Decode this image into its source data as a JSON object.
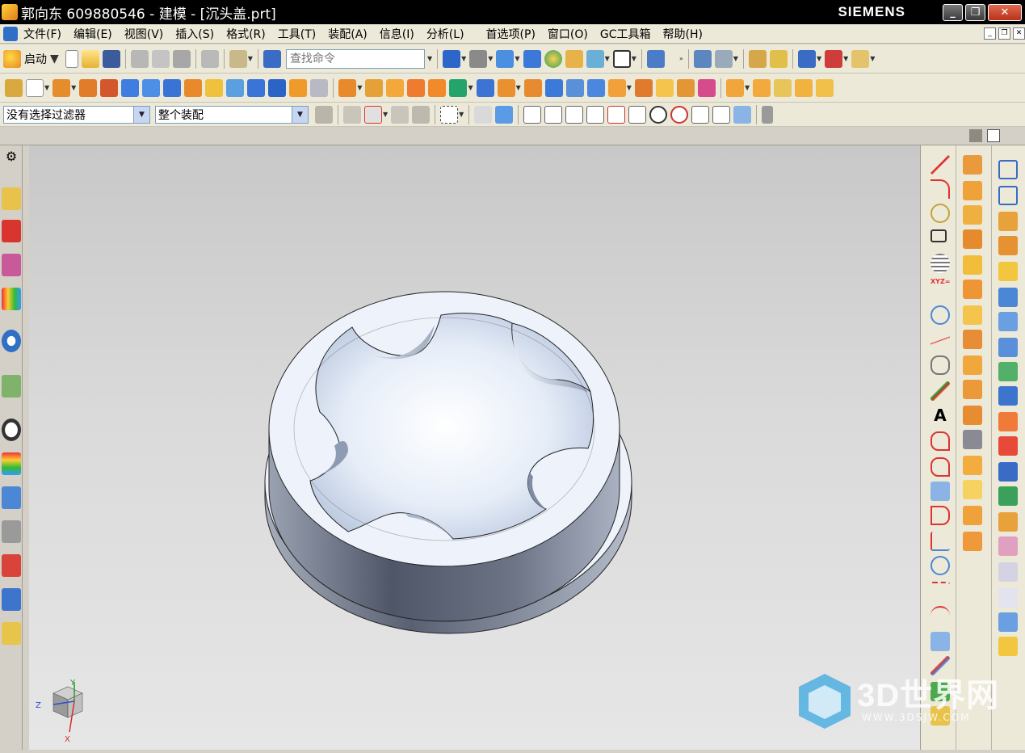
{
  "window": {
    "title": "郭向东 609880546 - 建模 - [沉头盖.prt]",
    "brand": "SIEMENS",
    "controls": [
      "_",
      "❐",
      "✕"
    ]
  },
  "menu": {
    "items": [
      "文件(F)",
      "编辑(E)",
      "视图(V)",
      "插入(S)",
      "格式(R)",
      "工具(T)",
      "装配(A)",
      "信息(I)",
      "分析(L)",
      "首选项(P)",
      "窗口(O)",
      "GC工具箱",
      "帮助(H)"
    ]
  },
  "toolbar": {
    "start_label": "启动",
    "search_placeholder": "查找命令"
  },
  "selection": {
    "filter": "没有选择过滤器",
    "scope": "整个装配"
  },
  "viewport": {
    "model_name": "沉头盖",
    "triad": {
      "z": "Z",
      "y": "Y",
      "x": "X"
    }
  },
  "watermark": {
    "brand": "3D世界网",
    "url": "WWW.3DSJW.COM"
  },
  "palette": {
    "accent_blue": "#2f6fc6",
    "part_face": "#eef3fb",
    "part_side": "#6c7486",
    "viewport_bg": "#d8d8d8"
  }
}
